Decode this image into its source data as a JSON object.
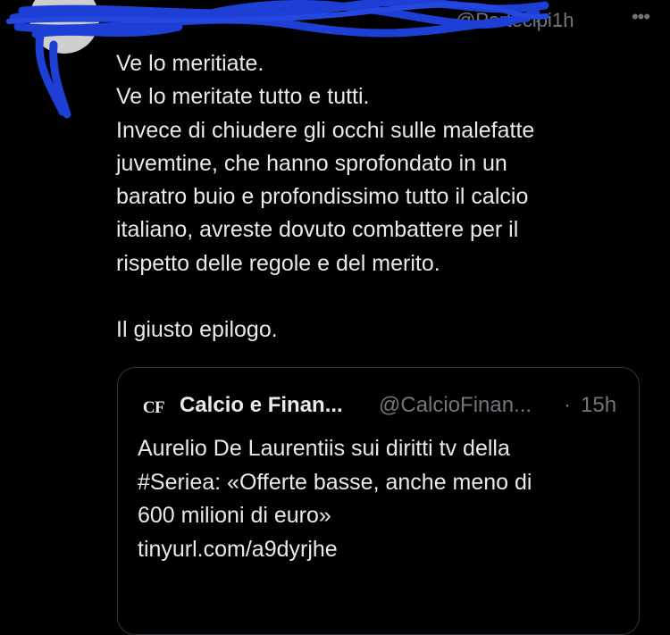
{
  "tweet": {
    "author_handle_partial": "@Partecipi...",
    "separator": "·",
    "time": "1h",
    "more_icon": "more-horizontal-icon",
    "text_lines": [
      "Ve lo meritiate.",
      "Ve lo meritate tutto e tutti.",
      "Invece di chiudere gli occhi sulle malefatte",
      "juvemtine, che hanno sprofondato in un",
      "baratro buio e profondissimo tutto il calcio",
      "italiano, avreste dovuto combattere per il",
      "rispetto delle regole e del merito.",
      "Il giusto epilogo."
    ]
  },
  "quote": {
    "avatar_text": "CF",
    "name": "Calcio e Finan...",
    "handle": "@CalcioFinan...",
    "separator": "·",
    "time": "15h",
    "text_lines": [
      "Aurelio De Laurentiis sui diritti tv della",
      "#Seriea: «Offerte basse, anche meno di",
      "600 milioni di euro»",
      "tinyurl.com/a9dyrjhe"
    ]
  },
  "colors": {
    "background": "#000000",
    "text": "#e7e9ea",
    "muted": "#71767b",
    "border": "#333639",
    "redaction": "#1d3fd6"
  }
}
